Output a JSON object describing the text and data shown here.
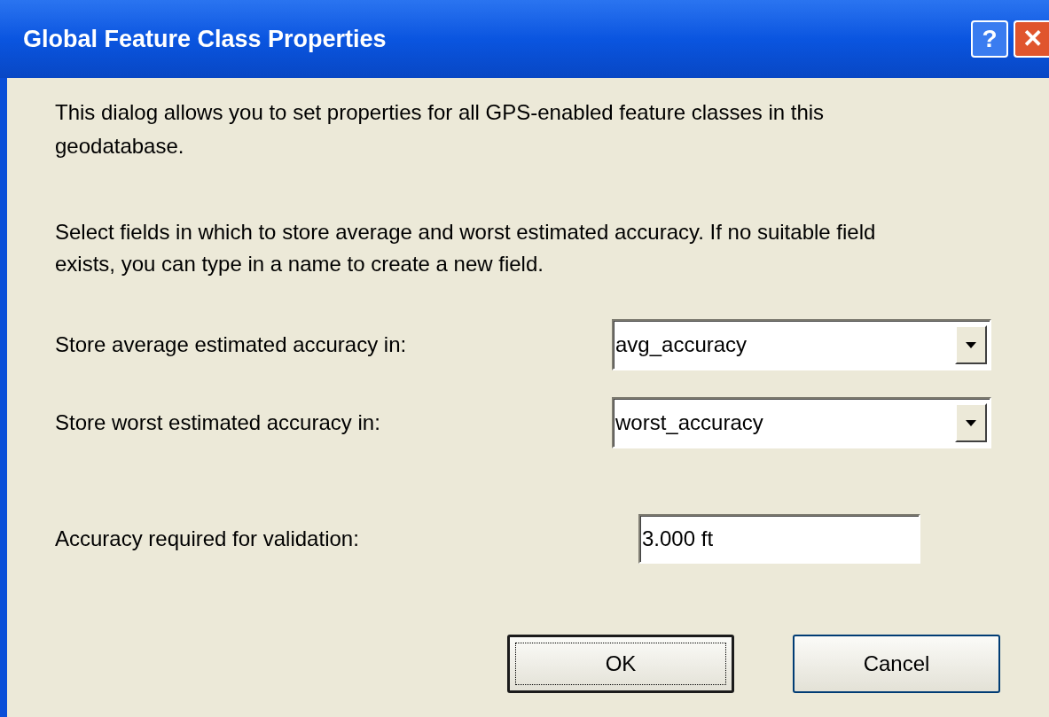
{
  "window": {
    "title": "Global Feature Class Properties",
    "buttons": [
      "?",
      "✕"
    ]
  },
  "intro": "This dialog allows you to set properties for all GPS-enabled feature classes in this geodatabase.",
  "instructions": "Select fields in which to store average and worst estimated accuracy. If no suitable field exists, you can type in a name to create a new field.",
  "fields": [
    {
      "label": "Store average estimated accuracy in:",
      "value": "avg_accuracy",
      "kind": "combo"
    },
    {
      "label": "Store worst estimated accuracy in:",
      "value": "worst_accuracy",
      "kind": "combo"
    },
    {
      "label": "Accuracy required for validation:",
      "value": "3.000 ft",
      "kind": "text"
    }
  ],
  "buttons": [
    {
      "label": "OK",
      "default": true
    },
    {
      "label": "Cancel",
      "default": false
    }
  ]
}
